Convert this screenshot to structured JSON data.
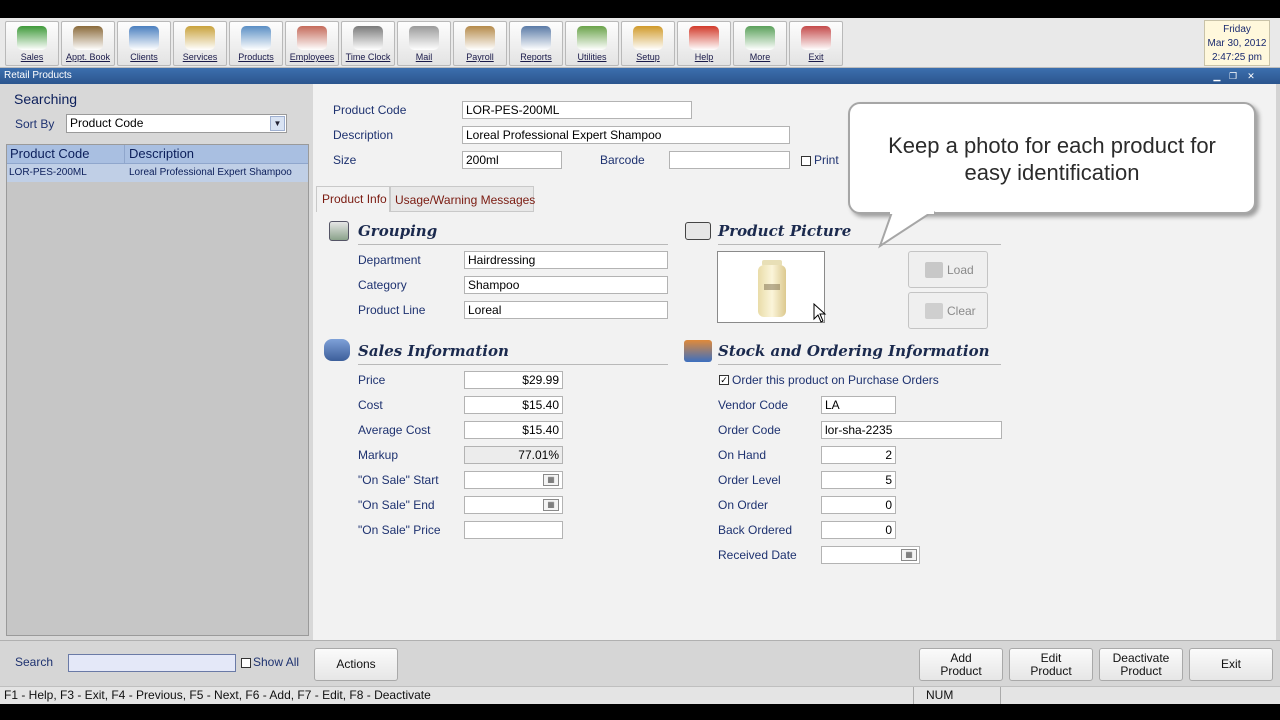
{
  "toolbar": {
    "buttons": [
      {
        "label": "Sales",
        "icon": "sales-icon",
        "color": "#3f9a3a"
      },
      {
        "label": "Appt. Book",
        "icon": "appointment-book-icon",
        "color": "#8a6a3a"
      },
      {
        "label": "Clients",
        "icon": "clients-icon",
        "color": "#4a7fbf"
      },
      {
        "label": "Services",
        "icon": "services-icon",
        "color": "#c9a23c"
      },
      {
        "label": "Products",
        "icon": "products-icon",
        "color": "#5a8ec4"
      },
      {
        "label": "Employees",
        "icon": "employees-icon",
        "color": "#c46a5a"
      },
      {
        "label": "Time Clock",
        "icon": "time-clock-icon",
        "color": "#7a7a7a"
      },
      {
        "label": "Mail",
        "icon": "mail-icon",
        "color": "#9a9a9a"
      },
      {
        "label": "Payroll",
        "icon": "payroll-icon",
        "color": "#b58a4a"
      },
      {
        "label": "Reports",
        "icon": "reports-icon",
        "color": "#5a7aa6"
      },
      {
        "label": "Utilities",
        "icon": "utilities-icon",
        "color": "#6aa34a"
      },
      {
        "label": "Setup",
        "icon": "setup-icon",
        "color": "#d09a2a"
      },
      {
        "label": "Help",
        "icon": "help-icon",
        "color": "#d23a2a"
      },
      {
        "label": "More",
        "icon": "more-icon",
        "color": "#5aa05a"
      },
      {
        "label": "Exit",
        "icon": "exit-icon",
        "color": "#c44a4a"
      }
    ]
  },
  "clock": {
    "day": "Friday",
    "date": "Mar 30, 2012",
    "time": "2:47:25 pm"
  },
  "window": {
    "title": "Retail Products"
  },
  "left": {
    "heading": "Searching",
    "sort_label": "Sort By",
    "sort_value": "Product Code",
    "columns": [
      "Product Code",
      "Description"
    ],
    "rows": [
      {
        "code": "LOR-PES-200ML",
        "description": "Loreal Professional Expert Shampoo"
      }
    ]
  },
  "product": {
    "code_label": "Product Code",
    "code": "LOR-PES-200ML",
    "desc_label": "Description",
    "description": "Loreal Professional Expert Shampoo",
    "size_label": "Size",
    "size": "200ml",
    "barcode_label": "Barcode",
    "barcode": "",
    "print_label": "Print"
  },
  "tabs": [
    "Product Info",
    "Usage/Warning Messages"
  ],
  "grouping": {
    "title": "Grouping",
    "department_label": "Department",
    "department": "Hairdressing",
    "category_label": "Category",
    "category": "Shampoo",
    "line_label": "Product Line",
    "line": "Loreal"
  },
  "sales": {
    "title": "Sales Information",
    "price_label": "Price",
    "price": "$29.99",
    "cost_label": "Cost",
    "cost": "$15.40",
    "avg_cost_label": "Average Cost",
    "avg_cost": "$15.40",
    "markup_label": "Markup",
    "markup": "77.01%",
    "sale_start_label": "\"On Sale\" Start",
    "sale_end_label": "\"On Sale\" End",
    "sale_price_label": "\"On Sale\" Price"
  },
  "picture": {
    "title": "Product Picture",
    "load": "Load",
    "clear": "Clear"
  },
  "stock": {
    "title": "Stock and Ordering Information",
    "order_check_label": "Order this product on Purchase Orders",
    "vendor_label": "Vendor Code",
    "vendor": "LA",
    "order_code_label": "Order Code",
    "order_code": "lor-sha-2235",
    "on_hand_label": "On Hand",
    "on_hand": "2",
    "order_level_label": "Order Level",
    "order_level": "5",
    "on_order_label": "On Order",
    "on_order": "0",
    "back_ordered_label": "Back Ordered",
    "back_ordered": "0",
    "received_label": "Received Date"
  },
  "callout": {
    "text": "Keep a photo for each product for easy identification"
  },
  "bottom": {
    "search_label": "Search",
    "show_all_label": "Show All",
    "actions": "Actions",
    "add_line1": "Add",
    "add_line2": "Product",
    "edit_line1": "Edit",
    "edit_line2": "Product",
    "deactivate_line1": "Deactivate",
    "deactivate_line2": "Product",
    "exit": "Exit"
  },
  "status": {
    "keys": "F1 - Help, F3 - Exit, F4 - Previous, F5 - Next, F6 - Add, F7 - Edit, F8 - Deactivate",
    "num": "NUM"
  }
}
